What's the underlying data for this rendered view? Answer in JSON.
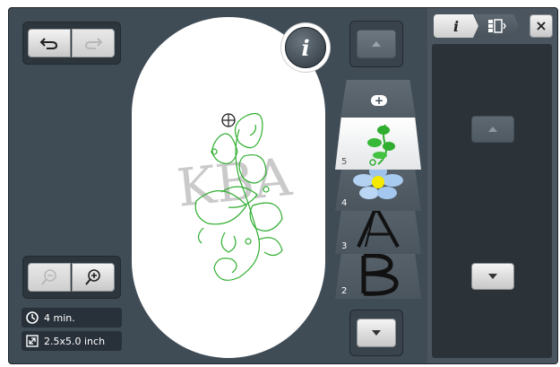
{
  "toolbar": {
    "undo_icon": "undo-arrow",
    "redo_icon": "redo-arrow"
  },
  "info_button": {
    "label": "i"
  },
  "zoom": {
    "zoom_out_icon": "zoom-out",
    "zoom_in_icon": "zoom-in"
  },
  "status": {
    "time_value": "4 min.",
    "size_value": "2.5x5.0 inch"
  },
  "layers": {
    "items": [
      {
        "number": "5"
      },
      {
        "number": "4"
      },
      {
        "number": "3"
      },
      {
        "number": "2"
      }
    ]
  },
  "preview": {
    "watermark_text": "KBA"
  },
  "right_panel": {
    "info_tab_label": "i",
    "close_label": "×"
  },
  "colors": {
    "background": "#3f4b55",
    "panel": "#2d363d",
    "hoop": "#ffffff",
    "stitch_green": "#2fae2f"
  }
}
